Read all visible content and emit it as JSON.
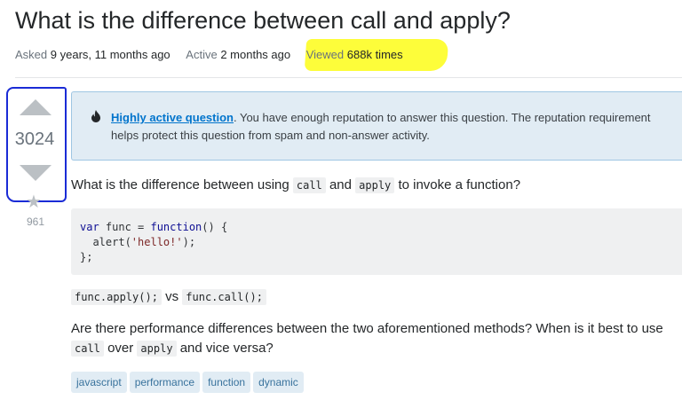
{
  "question": {
    "title": "What is the difference between call and apply?",
    "asked_label": "Asked",
    "asked_value": "9 years, 11 months ago",
    "active_label": "Active",
    "active_value": "2 months ago",
    "viewed_label": "Viewed",
    "viewed_value": "688k times"
  },
  "votes": {
    "score": "3024",
    "favorite_count": "961"
  },
  "notice": {
    "link_text": "Highly active question",
    "text": ". You have enough reputation to answer this question. The reputation requirement helps protect this question from spam and non-answer activity."
  },
  "body": {
    "intro_before": "What is the difference between using ",
    "code_call": "call",
    "intro_mid": " and ",
    "code_apply": "apply",
    "intro_after": " to invoke a function?",
    "code_line1_kw": "var",
    "code_line1_rest": " func = ",
    "code_line1_kw2": "function",
    "code_line1_end": "() {",
    "code_line2_start": "  alert(",
    "code_line2_str": "'hello!'",
    "code_line2_end": ");",
    "code_line3": "};",
    "calls_apply": "func.apply();",
    "calls_vs": " vs ",
    "calls_call": "func.call();",
    "para_before": "Are there performance differences between the two aforementioned methods? When is it best to use ",
    "para_code_call": "call",
    "para_mid": " over ",
    "para_code_apply": "apply",
    "para_after": " and vice versa?"
  },
  "tags": [
    "javascript",
    "performance",
    "function",
    "dynamic"
  ],
  "colors": {
    "highlight": "#fdfd3a",
    "annotation_box": "#1a2bd6",
    "notice_bg": "#e1ecf4",
    "link": "#0074cc",
    "tag_bg": "#e1ecf4",
    "tag_text": "#39739d"
  },
  "icons": {
    "notice_icon": "fire-icon",
    "favorite_icon": "star-icon"
  }
}
